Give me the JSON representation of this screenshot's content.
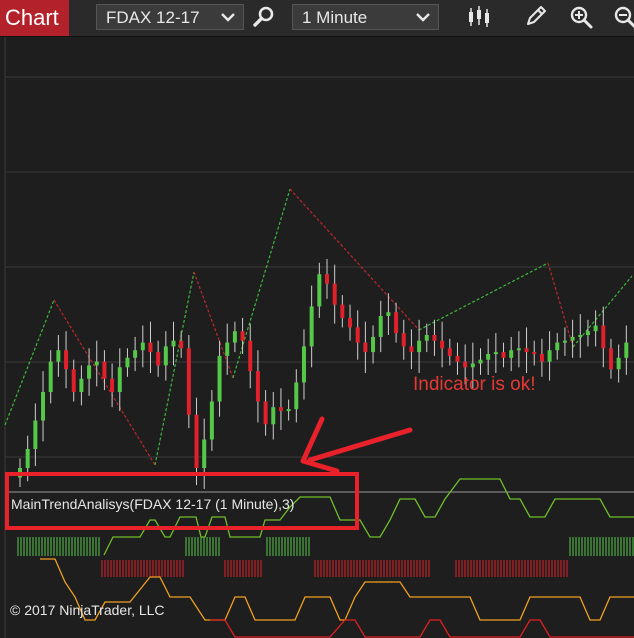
{
  "toolbar": {
    "tab_label": "Chart",
    "instrument": "FDAX 12-17",
    "interval": "1 Minute",
    "icons": [
      "chevron-down-icon",
      "search-icon",
      "bar-style-icon",
      "pencil-icon",
      "zoom-in-icon",
      "zoom-out-icon"
    ]
  },
  "indicator": {
    "label": "MainTrendAnalisys(FDAX 12-17 (1 Minute),3)"
  },
  "annotation": {
    "text": "Indicator is ok!"
  },
  "footer": {
    "copyright": "© 2017 NinjaTrader, LLC"
  },
  "colors": {
    "background": "#1e1e1e",
    "up_candle": "#55c84a",
    "down_candle": "#e0212b",
    "trend_up": "#3cb83c",
    "trend_down": "#c0282a",
    "highlight": "#e8212b",
    "step_green": "#6fbf2a",
    "step_orange": "#f0a020",
    "step_red": "#e02020"
  },
  "chart_data": {
    "type": "candlestick",
    "candle_count": 80,
    "candles_close_trace": [
      6.0,
      7.0,
      8.5,
      10.0,
      11.6,
      12.2,
      11.2,
      10.0,
      10.7,
      11.4,
      11.6,
      10.7,
      10.0,
      11.3,
      11.8,
      12.2,
      12.6,
      12.1,
      11.4,
      12.4,
      12.7,
      12.3,
      8.8,
      6.0,
      7.5,
      9.5,
      11.9,
      12.6,
      13.2,
      12.7,
      11.1,
      9.5,
      8.3,
      9.2,
      9.0,
      9.1,
      10.5,
      12.4,
      14.5,
      16.2,
      15.7,
      14.6,
      13.9,
      13.4,
      12.6,
      12.1,
      12.9,
      14.0,
      14.2,
      13.1,
      12.4,
      12.1,
      12.7,
      13.0,
      12.7,
      12.3,
      11.9,
      11.6,
      11.3,
      11.5,
      11.7,
      12.0,
      12.1,
      11.8,
      12.2,
      12.3,
      12.1,
      12.0,
      11.6,
      12.2,
      12.6,
      12.7,
      12.9,
      13.0,
      13.2,
      13.5,
      12.3,
      11.2,
      11.8,
      12.6
    ]
  }
}
